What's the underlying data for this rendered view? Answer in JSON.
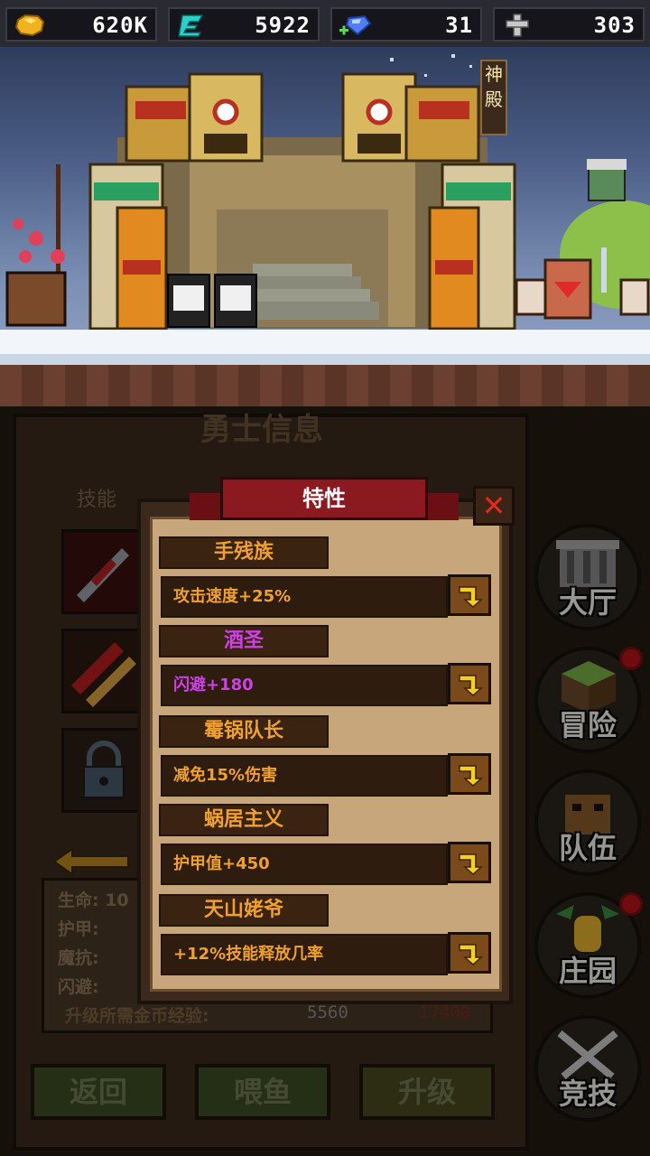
{
  "resources": [
    {
      "icon": "gold-icon",
      "value": "620K"
    },
    {
      "icon": "gem-e-icon",
      "value": "5922"
    },
    {
      "icon": "diamond-icon",
      "value": "31"
    },
    {
      "icon": "cross-icon",
      "value": "303"
    }
  ],
  "scene": {
    "temple_sign": "神殿"
  },
  "panel": {
    "title": "勇士信息",
    "skill_header": "技能",
    "stats": [
      "生命: 10",
      "护甲:",
      "魔抗:",
      "闪避:"
    ],
    "exp_label": "升级所需金币经验:",
    "exp_value": "5560",
    "exp_value2": "17400",
    "buttons": {
      "back": "返回",
      "feed": "喂鱼",
      "upgrade": "升级"
    }
  },
  "nav": [
    {
      "label": "大厅",
      "badge": false
    },
    {
      "label": "冒险",
      "badge": true
    },
    {
      "label": "队伍",
      "badge": false
    },
    {
      "label": "庄园",
      "badge": true
    },
    {
      "label": "竞技",
      "badge": false
    }
  ],
  "dialog": {
    "title": "特性",
    "traits": [
      {
        "name": "手残族",
        "effect": "攻击速度+25%",
        "color": "#f0a030"
      },
      {
        "name": "酒圣",
        "effect": "闪避+180",
        "color": "#d040e8"
      },
      {
        "name": "霉锅队长",
        "effect": "减免15%伤害",
        "color": "#f0a030"
      },
      {
        "name": "蜗居主义",
        "effect": "护甲值+450",
        "color": "#f0a030"
      },
      {
        "name": "天山姥爷",
        "effect": "+12%技能释放几率",
        "color": "#f0a030"
      }
    ]
  }
}
